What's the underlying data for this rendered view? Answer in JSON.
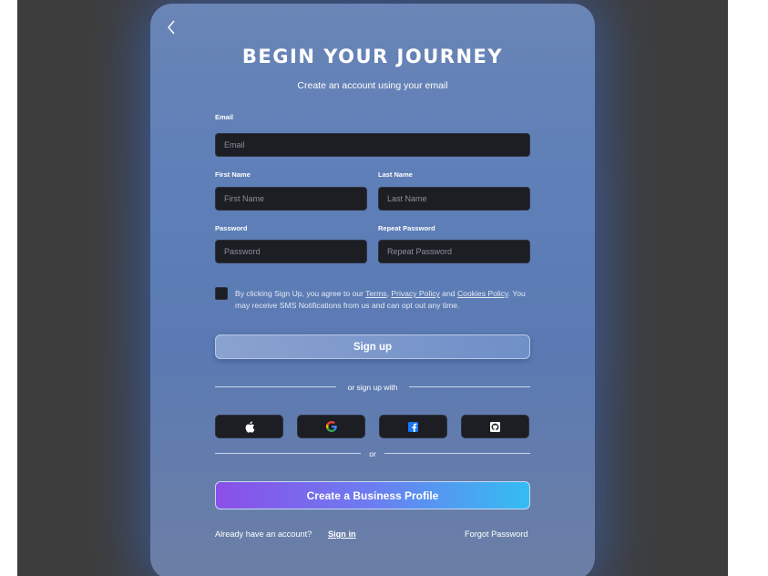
{
  "title": "BEGIN YOUR JOURNEY",
  "subtitle": "Create an account using your email",
  "form": {
    "email": {
      "label": "Email",
      "placeholder": "Email"
    },
    "first_name": {
      "label": "First Name",
      "placeholder": "First Name"
    },
    "last_name": {
      "label": "Last Name",
      "placeholder": "Last Name"
    },
    "password": {
      "label": "Password",
      "placeholder": "Password"
    },
    "repeat_password": {
      "label": "Repeat Password",
      "placeholder": "Repeat Password"
    }
  },
  "terms": {
    "prefix": "By clicking Sign Up, you agree to our ",
    "terms_link": "Terms",
    "comma": ", ",
    "privacy_link": "Privacy Policy",
    "and": " and ",
    "cookies_link": "Cookies Policy",
    "suffix": ". You may receive SMS Notifications from us and can opt out any time.",
    "checked": false
  },
  "signup_button": "Sign up",
  "or_sign_up_with": "or sign up with",
  "social": [
    {
      "icon": "apple-icon"
    },
    {
      "icon": "google-icon"
    },
    {
      "icon": "facebook-icon"
    },
    {
      "icon": "github-icon"
    }
  ],
  "or": "or",
  "business_button": "Create a Business Profile",
  "footer": {
    "already": "Already  have an account?",
    "sign_in": "Sign in",
    "forgot": "Forgot Password"
  },
  "colors": {
    "card_bg": "#5e7fb8",
    "input_bg": "#1c1e24",
    "business_gradient_start": "#8a4fe8",
    "business_gradient_end": "#34bdf2"
  }
}
